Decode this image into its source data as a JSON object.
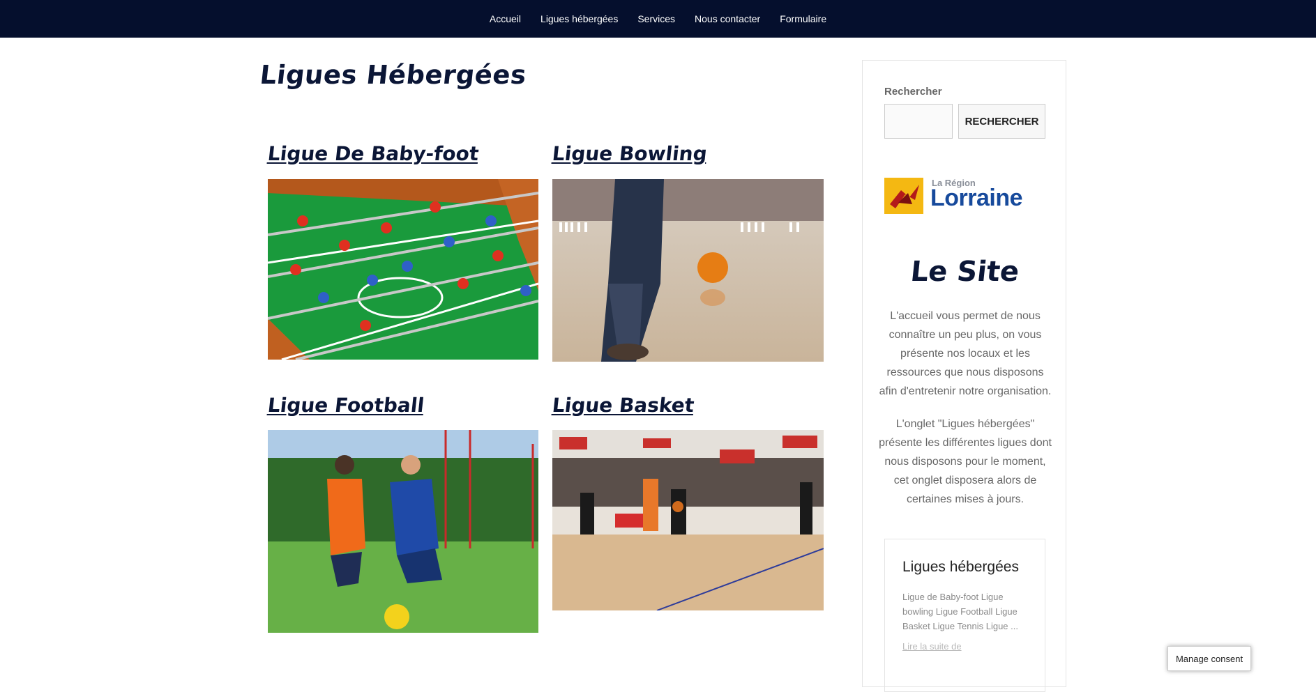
{
  "nav": {
    "items": [
      {
        "label": "Accueil"
      },
      {
        "label": "Ligues hébergées"
      },
      {
        "label": "Services"
      },
      {
        "label": "Nous contacter"
      },
      {
        "label": "Formulaire"
      }
    ]
  },
  "page": {
    "title": "Ligues Hébergées"
  },
  "leagues": [
    {
      "title": "Ligue De Baby-foot"
    },
    {
      "title": "Ligue Bowling"
    },
    {
      "title": "Ligue Football"
    },
    {
      "title": "Ligue Basket"
    }
  ],
  "sidebar": {
    "search_label": "Rechercher",
    "search_button": "RECHERCHER",
    "logo_small": "La Région",
    "logo_big": "Lorraine",
    "site_title": "Le Site",
    "desc_1": "L'accueil vous permet de nous connaître un peu plus, on vous présente nos locaux et les ressources que nous disposons afin d'entretenir notre organisation.",
    "desc_2": "L'onglet \"Ligues hébergées\" présente les différentes ligues dont nous disposons pour le moment, cet onglet disposera alors de certaines mises à jours.",
    "widget_title": "Ligues hébergées",
    "widget_text": "Ligue de Baby-foot Ligue bowling Ligue Football Ligue Basket Ligue Tennis Ligue ...",
    "widget_more": "Lire la suite de"
  },
  "consent": {
    "label": "Manage consent"
  }
}
